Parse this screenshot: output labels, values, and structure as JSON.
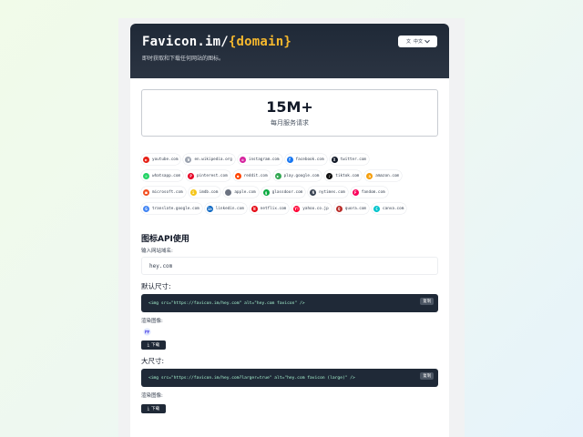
{
  "header": {
    "title_prefix": "Favicon.im/",
    "title_domain": "{domain}",
    "subtitle": "即时获取和下载任何网站的图标。",
    "lang_label": "中文"
  },
  "stat": {
    "number": "15M+",
    "label": "每月服务请求"
  },
  "sites": [
    [
      {
        "name": "youtube.com",
        "c": "#e62117",
        "g": "▶"
      },
      {
        "name": "en.wikipedia.org",
        "c": "#9ca3af",
        "g": "W"
      },
      {
        "name": "instagram.com",
        "c": "#d6249f",
        "g": "◎"
      },
      {
        "name": "facebook.com",
        "c": "#1877f2",
        "g": "f"
      },
      {
        "name": "twitter.com",
        "c": "#111827",
        "g": "X"
      }
    ],
    [
      {
        "name": "whatsapp.com",
        "c": "#25d366",
        "g": "✆"
      },
      {
        "name": "pinterest.com",
        "c": "#e60023",
        "g": "P"
      },
      {
        "name": "reddit.com",
        "c": "#ff4500",
        "g": "●"
      },
      {
        "name": "play.google.com",
        "c": "#34a853",
        "g": "▶"
      },
      {
        "name": "tiktok.com",
        "c": "#111111",
        "g": "♪"
      },
      {
        "name": "amazon.com",
        "c": "#f59e0b",
        "g": "a"
      }
    ],
    [
      {
        "name": "microsoft.com",
        "c": "#f25022",
        "g": "■"
      },
      {
        "name": "imdb.com",
        "c": "#f5c518",
        "g": "i"
      },
      {
        "name": "apple.com",
        "c": "#6b7280",
        "g": ""
      },
      {
        "name": "glassdoor.com",
        "c": "#0caa41",
        "g": "g"
      },
      {
        "name": "nytimes.com",
        "c": "#374151",
        "g": "N"
      },
      {
        "name": "fandom.com",
        "c": "#fa005a",
        "g": "F"
      }
    ],
    [
      {
        "name": "translate.google.com",
        "c": "#4285f4",
        "g": "G"
      },
      {
        "name": "linkedin.com",
        "c": "#0a66c2",
        "g": "in"
      },
      {
        "name": "netflix.com",
        "c": "#e50914",
        "g": "N"
      },
      {
        "name": "yahoo.co.jp",
        "c": "#ff0033",
        "g": "Y!"
      },
      {
        "name": "quora.com",
        "c": "#b92b27",
        "g": "Q"
      },
      {
        "name": "canva.com",
        "c": "#00c4cc",
        "g": "C"
      }
    ]
  ],
  "api": {
    "section_title": "图标API使用",
    "input_label": "输入网站域名:",
    "input_value": "hey.com",
    "default_label": "默认尺寸:",
    "default_code": "<img src=\"https://favicon.im/hey.com\" alt=\"hey.com favicon\" />",
    "copy_label": "复制",
    "preview_label": "渲染图像:",
    "download_label": "下载",
    "large_label": "大尺寸:",
    "large_code": "<img src=\"https://favicon.im/hey.com?larger=true\" alt=\"hey.com favicon (large)\" />",
    "copy_label_2": "复制",
    "preview_label_2": "渲染图像:",
    "download_label_2": "下载"
  }
}
